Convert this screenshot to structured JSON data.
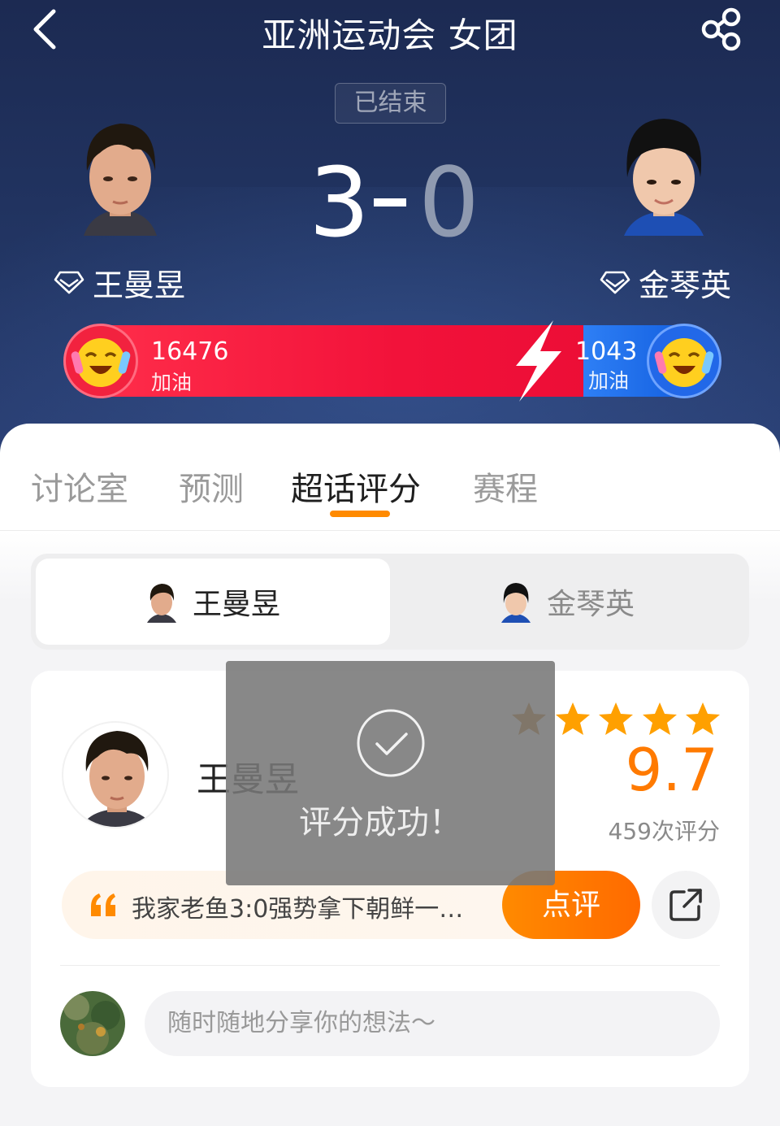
{
  "header": {
    "title": "亚洲运动会 女团",
    "status": "已结束"
  },
  "match": {
    "home": {
      "name": "王曼昱",
      "score": "3"
    },
    "away": {
      "name": "金琴英",
      "score": "0"
    }
  },
  "cheer": {
    "home_count": "16476",
    "home_label": "加油",
    "away_count": "1043",
    "away_label": "加油"
  },
  "tabs": [
    "讨论室",
    "预测",
    "超话评分",
    "赛程"
  ],
  "player_switch": {
    "active": "王曼昱",
    "inactive": "金琴英"
  },
  "card": {
    "player_name": "王曼昱",
    "stars": 5,
    "rating": "9.7",
    "rating_count": "459次评分",
    "comment": "我家老鱼3:0强势拿下朝鲜一…",
    "review_label": "点评",
    "input_placeholder": "随时随地分享你的想法～"
  },
  "toast": {
    "text": "评分成功！"
  },
  "colors": {
    "accent": "#ff7a00",
    "header_bg": "#223563",
    "cheer_red": "#f2123a",
    "cheer_blue": "#1e6ae8"
  }
}
